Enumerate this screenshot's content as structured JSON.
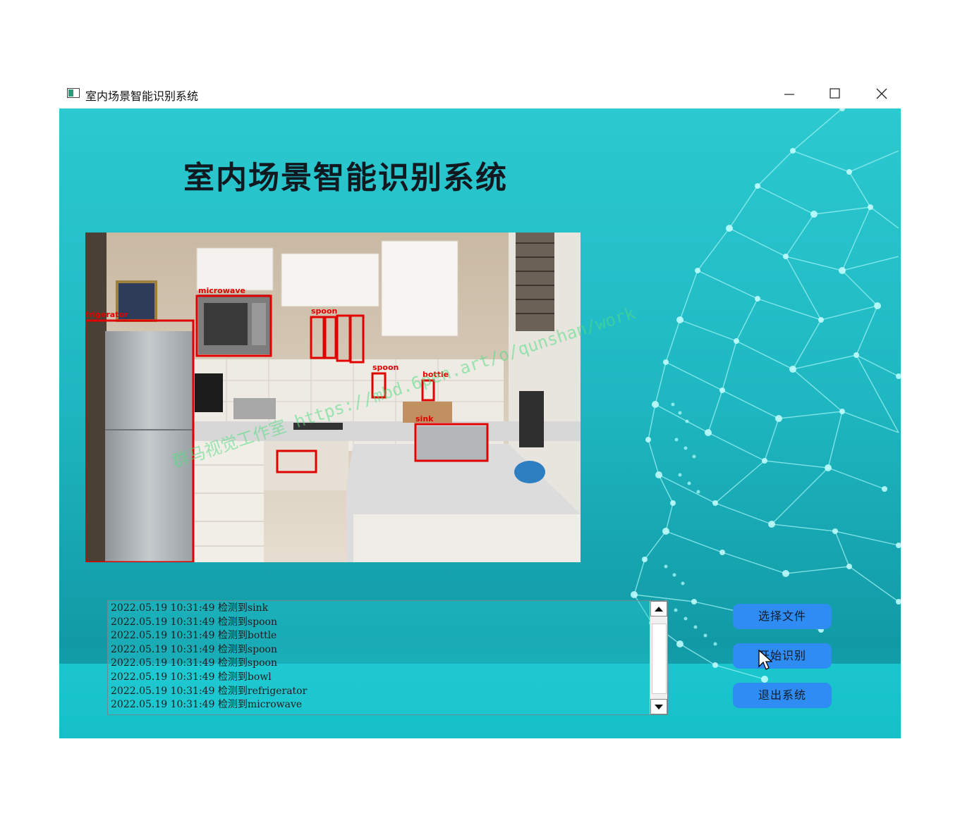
{
  "window": {
    "title": "室内场景智能识别系统",
    "controls": [
      "minimize-icon",
      "maximize-icon",
      "close-icon"
    ]
  },
  "heading": "室内场景智能识别系统",
  "detections": [
    {
      "label": "microwave"
    },
    {
      "label": "frigerator"
    },
    {
      "label": "spoon"
    },
    {
      "label": "spoon"
    },
    {
      "label": "bottle"
    },
    {
      "label": "sink"
    }
  ],
  "log": {
    "lines": [
      "2022.05.19 10:31:49 检测到sink",
      "2022.05.19 10:31:49 检测到spoon",
      "2022.05.19 10:31:49 检测到bottle",
      "2022.05.19 10:31:49 检测到spoon",
      "2022.05.19 10:31:49 检测到spoon",
      "2022.05.19 10:31:49 检测到bowl",
      "2022.05.19 10:31:49 检测到refrigerator",
      "2022.05.19 10:31:49 检测到microwave"
    ]
  },
  "buttons": {
    "select_file": "选择文件",
    "start_recognition": "开始识别",
    "exit_system": "退出系统"
  },
  "watermark": "群马视觉工作室 https://mbd.6pen.art/o/qunshan/work",
  "colors": {
    "background": "#1fb8c2",
    "button": "#2f8cf2",
    "box": "#e00000"
  }
}
